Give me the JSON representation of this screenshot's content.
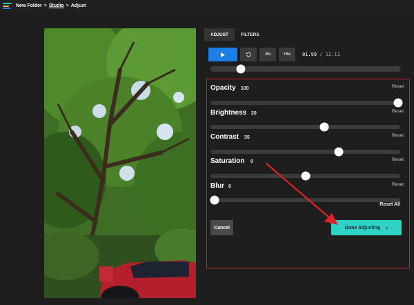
{
  "breadcrumb": {
    "folder": "New Folder",
    "studio": "Studio",
    "current": "Adjust",
    "separator": ">"
  },
  "tabs": [
    {
      "label": "ADJUST",
      "active": true
    },
    {
      "label": "FILTERS",
      "active": false
    }
  ],
  "playback": {
    "play_icon": "play-icon",
    "rewind_icon": "rewind-icon",
    "back_label": "-5s",
    "forward_label": "+5s",
    "current_time": "01.99",
    "separator": "/",
    "duration": "12.11",
    "progress": 0.16
  },
  "adjustments": [
    {
      "label": "Opacity",
      "value": "100",
      "reset": "Reset",
      "level": 0.99
    },
    {
      "label": "Brightness",
      "value": "20",
      "reset": "Reset",
      "level": 0.6
    },
    {
      "label": "Contrast",
      "value": "35",
      "reset": "Reset",
      "level": 0.675
    },
    {
      "label": "Saturation",
      "value": "0",
      "reset": "Reset",
      "level": 0.5
    },
    {
      "label": "Blur",
      "value": "0",
      "reset": "Reset",
      "level": 0.02
    }
  ],
  "reset_all": "Reset All",
  "buttons": {
    "cancel": "Cancel",
    "done": "Done Adjusting",
    "done_icon": "chevron-right-icon"
  },
  "colors": {
    "accent_blue": "#1d7fe5",
    "done_teal": "#2dd4c6",
    "highlight_red": "#d9202a"
  }
}
